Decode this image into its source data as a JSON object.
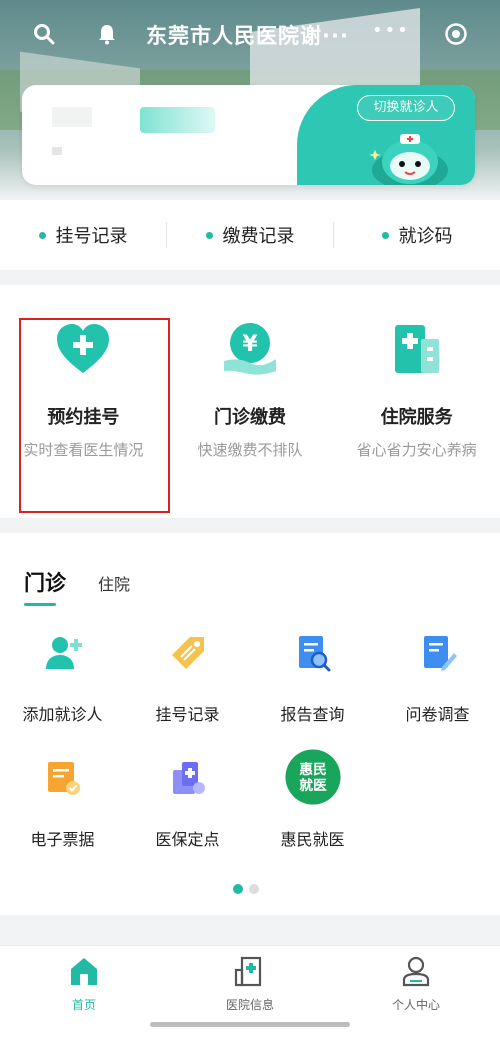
{
  "header": {
    "title": "东莞市人民医院谢···",
    "more": "•••"
  },
  "patient_card": {
    "switch_label": "切换就诊人"
  },
  "quick_records": [
    {
      "label": "挂号记录"
    },
    {
      "label": "缴费记录"
    },
    {
      "label": "就诊码"
    }
  ],
  "services": [
    {
      "title": "预约挂号",
      "subtitle": "实时查看医生情况",
      "icon": "heart-plus-icon"
    },
    {
      "title": "门诊缴费",
      "subtitle": "快速缴费不排队",
      "icon": "yuan-hand-icon"
    },
    {
      "title": "住院服务",
      "subtitle": "省心省力安心养病",
      "icon": "hospital-building-icon"
    }
  ],
  "tabs": {
    "active": "门诊",
    "inactive": "住院"
  },
  "grid_items": [
    {
      "label": "添加就诊人",
      "icon": "add-user-icon"
    },
    {
      "label": "挂号记录",
      "icon": "ticket-tag-icon"
    },
    {
      "label": "报告查询",
      "icon": "report-search-icon"
    },
    {
      "label": "问卷调查",
      "icon": "survey-edit-icon"
    },
    {
      "label": "电子票据",
      "icon": "e-receipt-icon"
    },
    {
      "label": "医保定点",
      "icon": "insurance-point-icon"
    },
    {
      "label": "惠民就医",
      "icon": "huimin-badge-icon",
      "badge_text": "惠民就医"
    }
  ],
  "pager": {
    "current": 1,
    "total": 2
  },
  "bottom_nav": [
    {
      "label": "首页",
      "active": true
    },
    {
      "label": "医院信息",
      "active": false
    },
    {
      "label": "个人中心",
      "active": false
    }
  ],
  "colors": {
    "accent": "#21bba5",
    "highlight": "#d9211d"
  }
}
